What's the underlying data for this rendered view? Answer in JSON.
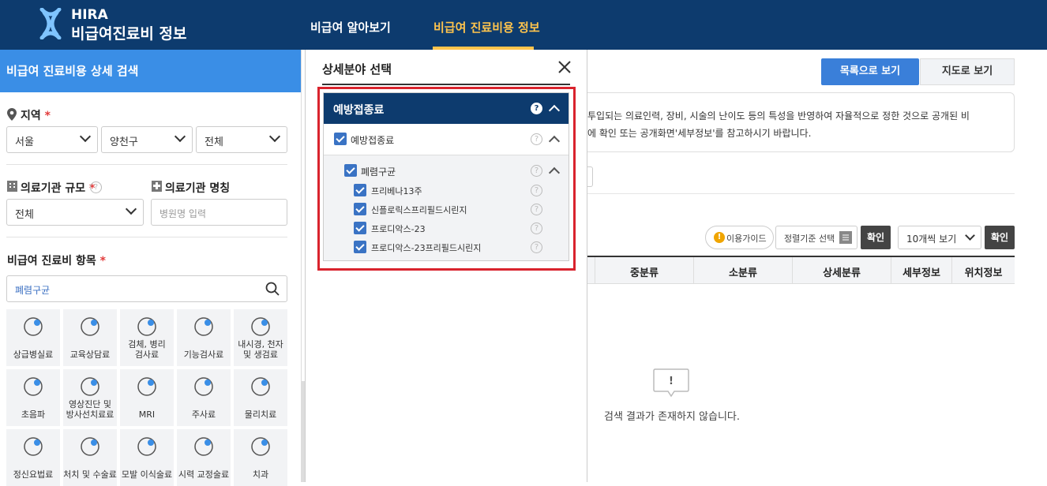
{
  "header": {
    "logo_line1": "HIRA",
    "logo_line2": "비급여진료비 정보",
    "nav": [
      "비급여 알아보기",
      "비급여 진료비용 정보"
    ],
    "accent": "#ffc44d",
    "bg": "#0d3b6e"
  },
  "sidebar": {
    "title": "비급여 진료비용 상세 검색",
    "region_label": "지역",
    "region_required": "*",
    "region_selects": [
      "서울",
      "양천구",
      "전체"
    ],
    "scale_label": "의료기관 규모",
    "scale_required": "*",
    "scale_value": "전체",
    "name_label": "의료기관 명칭",
    "name_placeholder": "병원명 입력",
    "items_label": "비급여 진료비 항목",
    "items_required": "*",
    "search_value": "폐렴구균",
    "categories": [
      {
        "label": "상급병실료",
        "icon": "hospital-bed-icon"
      },
      {
        "label": "교육상담료",
        "icon": "counseling-icon"
      },
      {
        "label": "검체, 병리\n검사료",
        "icon": "microscope-icon"
      },
      {
        "label": "기능검사료",
        "icon": "function-test-icon"
      },
      {
        "label": "내시경, 천자\n및 생검료",
        "icon": "endoscope-icon"
      },
      {
        "label": "초음파",
        "icon": "ultrasound-icon"
      },
      {
        "label": "영상진단 및\n방사선치료료",
        "icon": "radiology-icon"
      },
      {
        "label": "MRI",
        "icon": "mri-icon"
      },
      {
        "label": "주사료",
        "icon": "syringe-icon"
      },
      {
        "label": "물리치료",
        "icon": "physiotherapy-icon"
      },
      {
        "label": "정신요법료",
        "icon": "psychotherapy-icon"
      },
      {
        "label": "처치 및 수술료",
        "icon": "surgery-icon"
      },
      {
        "label": "모발 이식술료",
        "icon": "hair-transplant-icon"
      },
      {
        "label": "시력 교정술료",
        "icon": "eye-icon"
      },
      {
        "label": "치과",
        "icon": "tooth-icon"
      }
    ]
  },
  "modal": {
    "title": "상세분야 선택",
    "panel_title": "예방접종료",
    "level1": "예방접종료",
    "level2": "폐렴구균",
    "items": [
      "프리베나13주",
      "신플로릭스프리필드시린지",
      "프로디악스-23",
      "프로디악스-23프리필드시린지"
    ],
    "highlight_color": "#d9232d"
  },
  "main": {
    "view_list": "목록으로 보기",
    "view_map": "지도로 보기",
    "notice_line1": "투입되는 의료인력, 장비, 시술의 난이도 등의 특성을 반영하여 자율적으로 정한 것으로 공개된 비",
    "notice_line2": "에 확인 또는 공개화면'세부정보'를 참고하시기 바랍니다.",
    "guide_label": "이용가이드",
    "sort_label": "정렬기준 선택",
    "confirm_label": "확인",
    "pager_label": "10개씩 보기",
    "columns": [
      "중분류",
      "소분류",
      "상세분류",
      "세부정보",
      "위치정보"
    ],
    "empty_text": "검색 결과가 존재하지 않습니다."
  }
}
